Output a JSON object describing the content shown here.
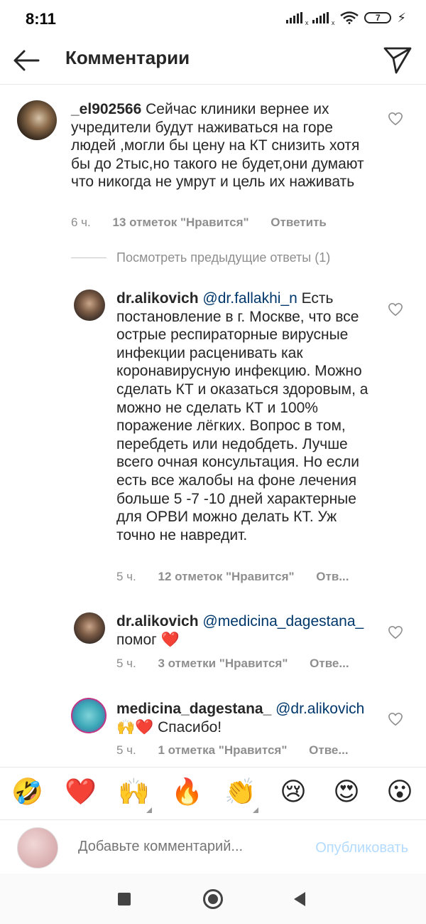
{
  "status_bar": {
    "time": "8:11",
    "battery": "7"
  },
  "header": {
    "title": "Комментарии"
  },
  "comments": [
    {
      "username": "_el902566",
      "text": "Сейчас клиники вернее их учредители будут наживаться на горе людей ,могли бы цену на КТ снизить хотя бы до 2тыс,но такого не будет,они думают что никогда не умрут и цель их наживать",
      "time": "6 ч.",
      "likes": "13 отметок \"Нравится\"",
      "reply": "Ответить"
    }
  ],
  "view_previous": "Посмотреть предыдущие ответы (1)",
  "replies": [
    {
      "username": "dr.alikovich",
      "mention": "@dr.fallakhi_n",
      "text": "Есть постановление в г. Москве, что все острые респираторные вирусные инфекции расценивать как коронавирусную инфекцию. Можно сделать КТ и оказаться здоровым, а можно не сделать КТ и 100% поражение лёгких. Вопрос в том, перебдеть или недобдеть. Лучше всего очная консультация. Но если есть все жалобы на фоне лечения больше 5 -7 -10 дней характерные для ОРВИ можно делать КТ. Уж точно не навредит.",
      "time": "5 ч.",
      "likes": "12 отметок \"Нравится\"",
      "reply": "Отв..."
    },
    {
      "username": "dr.alikovich",
      "mention": "@medicina_dagestana_",
      "text": "помог ❤️",
      "time": "5 ч.",
      "likes": "3 отметки \"Нравится\"",
      "reply": "Отве..."
    },
    {
      "username": "medicina_dagestana_",
      "mention": "@dr.alikovich",
      "text": "🙌❤️ Спасибо!",
      "time": "5 ч.",
      "likes": "1 отметка \"Нравится\"",
      "reply": "Отве..."
    }
  ],
  "emoji_bar": [
    "🤣",
    "❤️",
    "🙌",
    "🔥",
    "👏",
    "😢",
    "😍",
    "😮"
  ],
  "input": {
    "placeholder": "Добавьте комментарий...",
    "post_label": "Опубликовать"
  },
  "colors": {
    "mention": "#00376b",
    "post_disabled": "#b3dbff",
    "meta": "#8e8e8e"
  }
}
